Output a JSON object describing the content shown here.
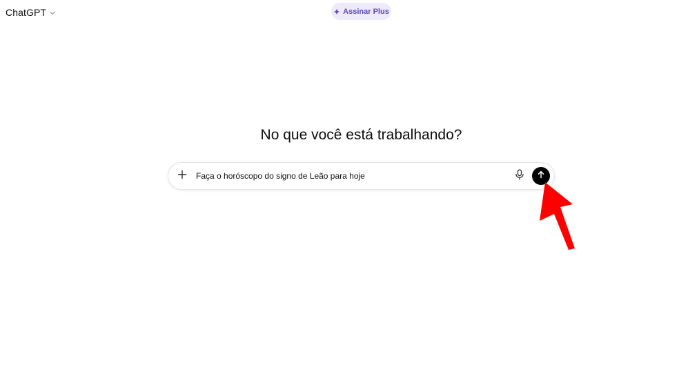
{
  "header": {
    "model_name": "ChatGPT",
    "model_chevron_icon": "chevron-down-icon",
    "upgrade_icon": "sparkle-icon",
    "upgrade_label": "Assinar Plus",
    "upgrade_color": "#5a4ab8",
    "upgrade_bg": "#eeeafc"
  },
  "main": {
    "headline": "No que você está trabalhando?"
  },
  "composer": {
    "attach_icon": "plus-icon",
    "value": "Faça o horóscopo do signo de Leão para hoje",
    "mic_icon": "microphone-icon",
    "send_icon": "arrow-up-icon",
    "send_bg": "#000000"
  },
  "annotation": {
    "icon": "red-pointer-arrow",
    "color": "#ff0000"
  }
}
